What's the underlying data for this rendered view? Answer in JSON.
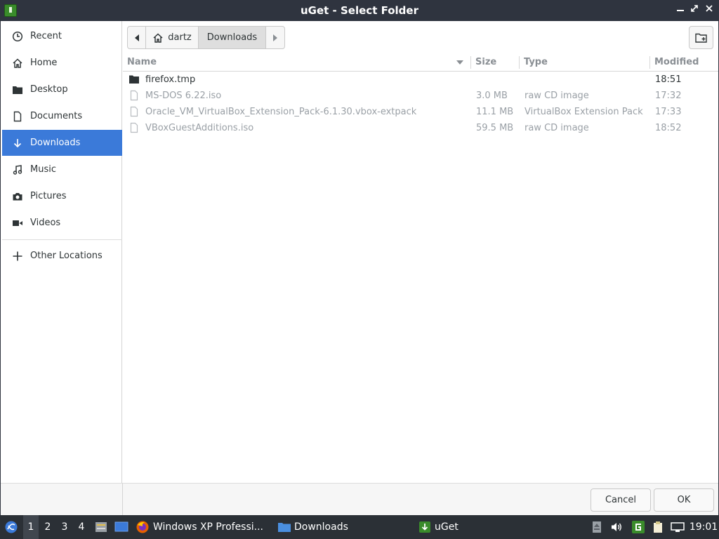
{
  "window": {
    "title": "uGet - Select Folder",
    "controls": {
      "minimize": "‒",
      "restore": "⤢",
      "close": "✕"
    }
  },
  "sidebar": {
    "items": [
      {
        "label": "Recent",
        "icon": "clock-icon"
      },
      {
        "label": "Home",
        "icon": "home-icon"
      },
      {
        "label": "Desktop",
        "icon": "desktop-folder-icon"
      },
      {
        "label": "Documents",
        "icon": "document-icon"
      },
      {
        "label": "Downloads",
        "icon": "download-icon",
        "active": true
      },
      {
        "label": "Music",
        "icon": "music-icon"
      },
      {
        "label": "Pictures",
        "icon": "camera-icon"
      },
      {
        "label": "Videos",
        "icon": "video-icon"
      }
    ],
    "other_locations": {
      "label": "Other Locations",
      "icon": "plus-icon"
    }
  },
  "pathbar": {
    "home_label": "dartz",
    "current": "Downloads"
  },
  "columns": {
    "name": "Name",
    "size": "Size",
    "type": "Type",
    "modified": "Modified"
  },
  "files": [
    {
      "name": "firefox.tmp",
      "size": "",
      "type": "",
      "modified": "18:51",
      "kind": "folder"
    },
    {
      "name": "MS-DOS 6.22.iso",
      "size": "3.0 MB",
      "type": "raw CD image",
      "modified": "17:32",
      "kind": "file"
    },
    {
      "name": "Oracle_VM_VirtualBox_Extension_Pack-6.1.30.vbox-extpack",
      "size": "11.1 MB",
      "type": "VirtualBox Extension Pack",
      "modified": "17:33",
      "kind": "file"
    },
    {
      "name": "VBoxGuestAdditions.iso",
      "size": "59.5 MB",
      "type": "raw CD image",
      "modified": "18:52",
      "kind": "file"
    }
  ],
  "buttons": {
    "cancel": "Cancel",
    "ok": "OK"
  },
  "taskbar": {
    "workspaces": [
      "1",
      "2",
      "3",
      "4"
    ],
    "tasks": [
      {
        "label": "Windows XP Professi...",
        "icon": "firefox-icon"
      },
      {
        "label": "Downloads",
        "icon": "folder-icon"
      },
      {
        "label": "uGet",
        "icon": "uget-icon"
      }
    ],
    "clock": "19:01"
  },
  "colors": {
    "accent": "#3b7ad9",
    "titlebar": "#2f343f",
    "taskbar": "#2b3036",
    "dim_text": "#9aa0a6"
  }
}
